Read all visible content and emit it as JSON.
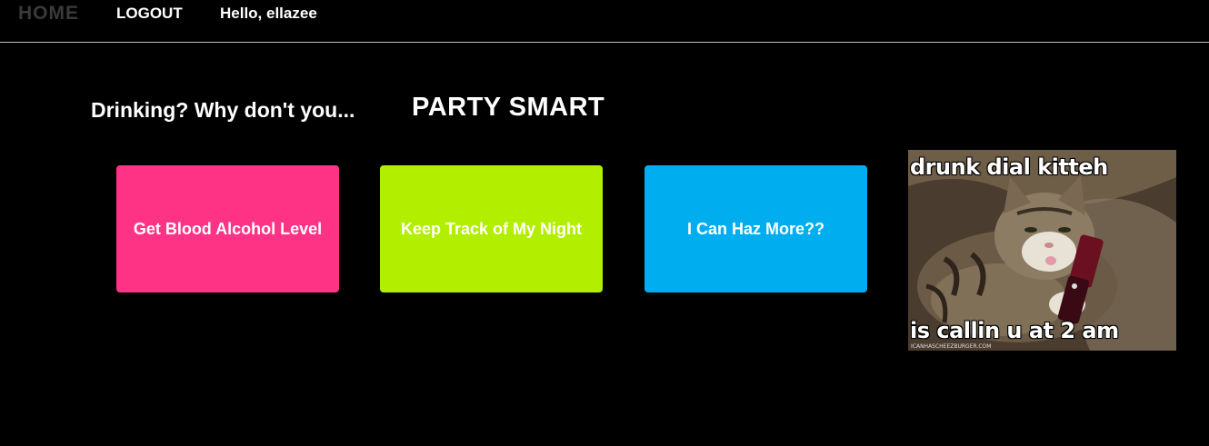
{
  "nav": {
    "home_label": "HOME",
    "logout_label": "LOGOUT",
    "greeting": "Hello, ellazee"
  },
  "hero": {
    "tagline": "Drinking? Why don't you...",
    "brand": "PARTY SMART"
  },
  "tiles": [
    {
      "label": "Get Blood Alcohol Level",
      "color": "#ff3385"
    },
    {
      "label": "Keep Track of My Night",
      "color": "#b2ee00"
    },
    {
      "label": "I Can Haz More??",
      "color": "#00aeef"
    }
  ],
  "meme": {
    "top_caption": "drunk dial kitteh",
    "bottom_caption": "is callin u at 2 am",
    "credit": "ICANHASCHEEZBURGER.COM"
  }
}
